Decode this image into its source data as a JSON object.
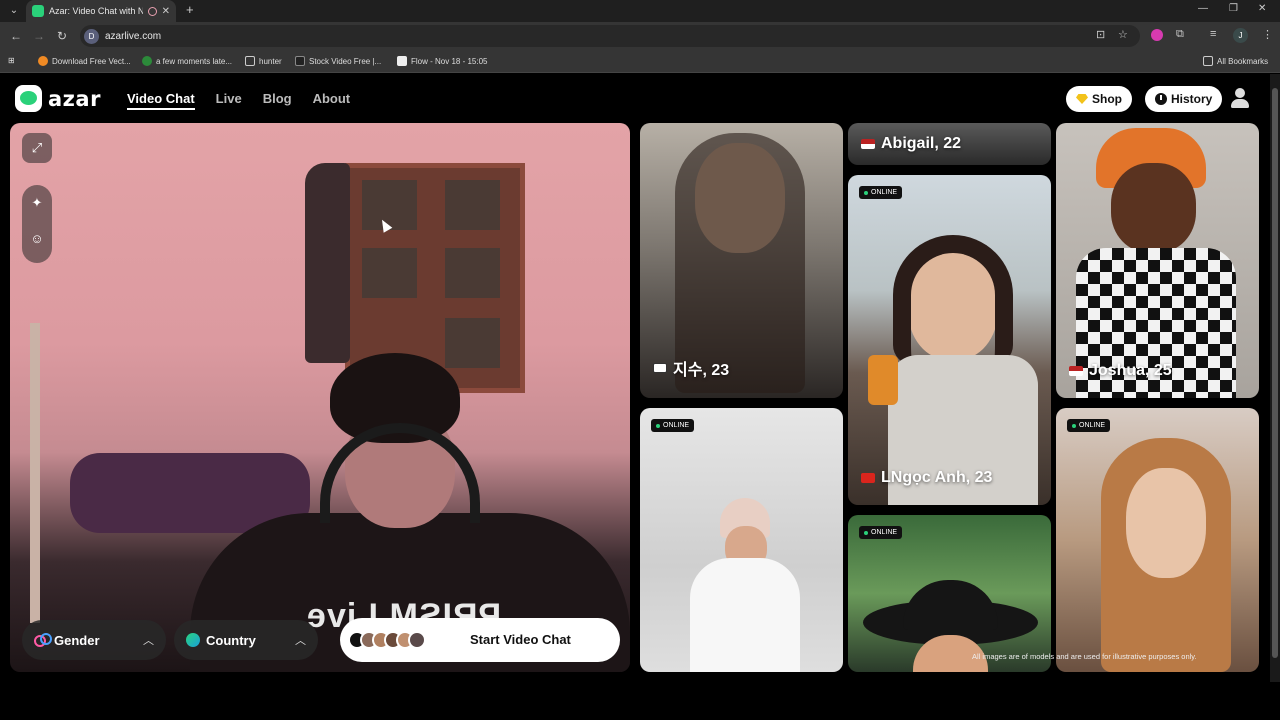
{
  "browser": {
    "tab_title": "Azar: Video Chat with New",
    "url": "azarlive.com",
    "profile_initial": "J",
    "site_icon_letter": "D",
    "bookmarks": [
      "Download Free Vect...",
      "a few moments late...",
      "hunter",
      "Stock Video Free |...",
      "Flow - Nov 18 - 15:05"
    ],
    "all_bookmarks": "All Bookmarks"
  },
  "site": {
    "logo_text": "azar",
    "nav": [
      "Video Chat",
      "Live",
      "Blog",
      "About"
    ],
    "shop_label": "Shop",
    "history_label": "History"
  },
  "cam": {
    "watermark": "PRISM Live"
  },
  "controls": {
    "gender_label": "Gender",
    "country_label": "Country",
    "start_label": "Start Video Chat"
  },
  "cards": [
    {
      "name": "지수, 23",
      "flag": "kr"
    },
    {
      "name": "Abigail, 22",
      "flag": "us"
    },
    {
      "name": "Joshua, 25",
      "flag": "us"
    },
    {
      "badge": "ONLINE",
      "name": "LNgọc Anh, 23",
      "flag": "vn"
    },
    {
      "badge": "ONLINE"
    },
    {
      "badge": "ONLINE"
    },
    {
      "badge": "ONLINE"
    },
    {
      "badge": "ONLINE"
    }
  ],
  "disclaimer": "All images are of models and are used for illustrative purposes only.",
  "colors": {
    "accent_green": "#2ad17a",
    "shop_gem": "#f2c21a"
  }
}
